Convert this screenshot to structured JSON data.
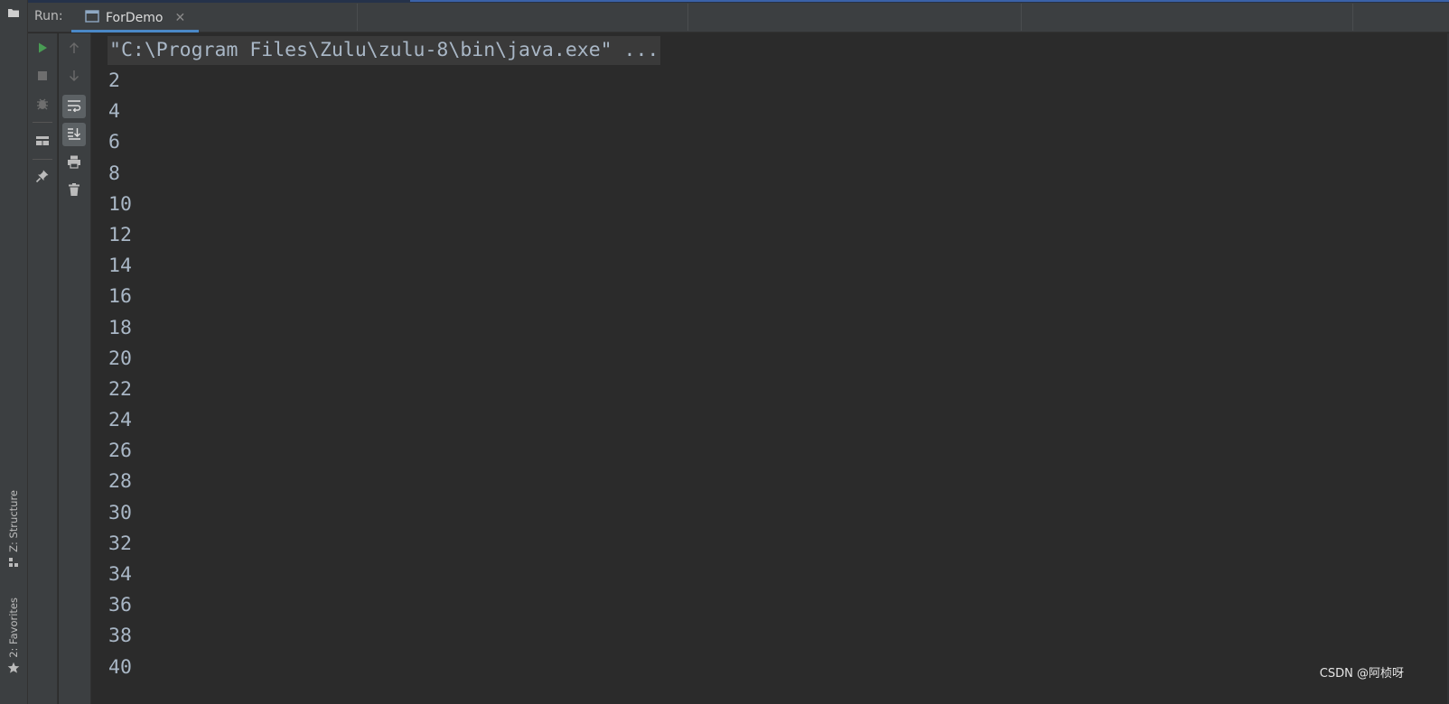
{
  "header": {
    "run_label": "Run:",
    "tab": {
      "label": "ForDemo",
      "close_icon": "close-icon"
    }
  },
  "left_stripe": {
    "structure_label": "Z: Structure",
    "favorites_label": "2: Favorites"
  },
  "toolbar_left": {
    "items": [
      {
        "name": "rerun-icon",
        "color": "#499c54"
      },
      {
        "name": "stop-icon"
      },
      {
        "name": "debug-icon"
      },
      {
        "name": "layout-icon"
      },
      {
        "name": "pin-icon"
      }
    ]
  },
  "toolbar_right": {
    "items": [
      {
        "name": "up-arrow-icon"
      },
      {
        "name": "down-arrow-icon"
      },
      {
        "name": "soft-wrap-icon",
        "toggled": true
      },
      {
        "name": "scroll-to-end-icon",
        "toggled": true
      },
      {
        "name": "print-icon"
      },
      {
        "name": "trash-icon"
      }
    ]
  },
  "console": {
    "command": "\"C:\\Program Files\\Zulu\\zulu-8\\bin\\java.exe\" ...",
    "lines": [
      "2",
      "4",
      "6",
      "8",
      "10",
      "12",
      "14",
      "16",
      "18",
      "20",
      "22",
      "24",
      "26",
      "28",
      "30",
      "32",
      "34",
      "36",
      "38",
      "40"
    ]
  },
  "watermark": "CSDN @阿桢呀",
  "colors": {
    "accent": "#4a88c7",
    "text": "#a9b7c6",
    "background": "#2b2b2b",
    "panel": "#3c3f41"
  }
}
